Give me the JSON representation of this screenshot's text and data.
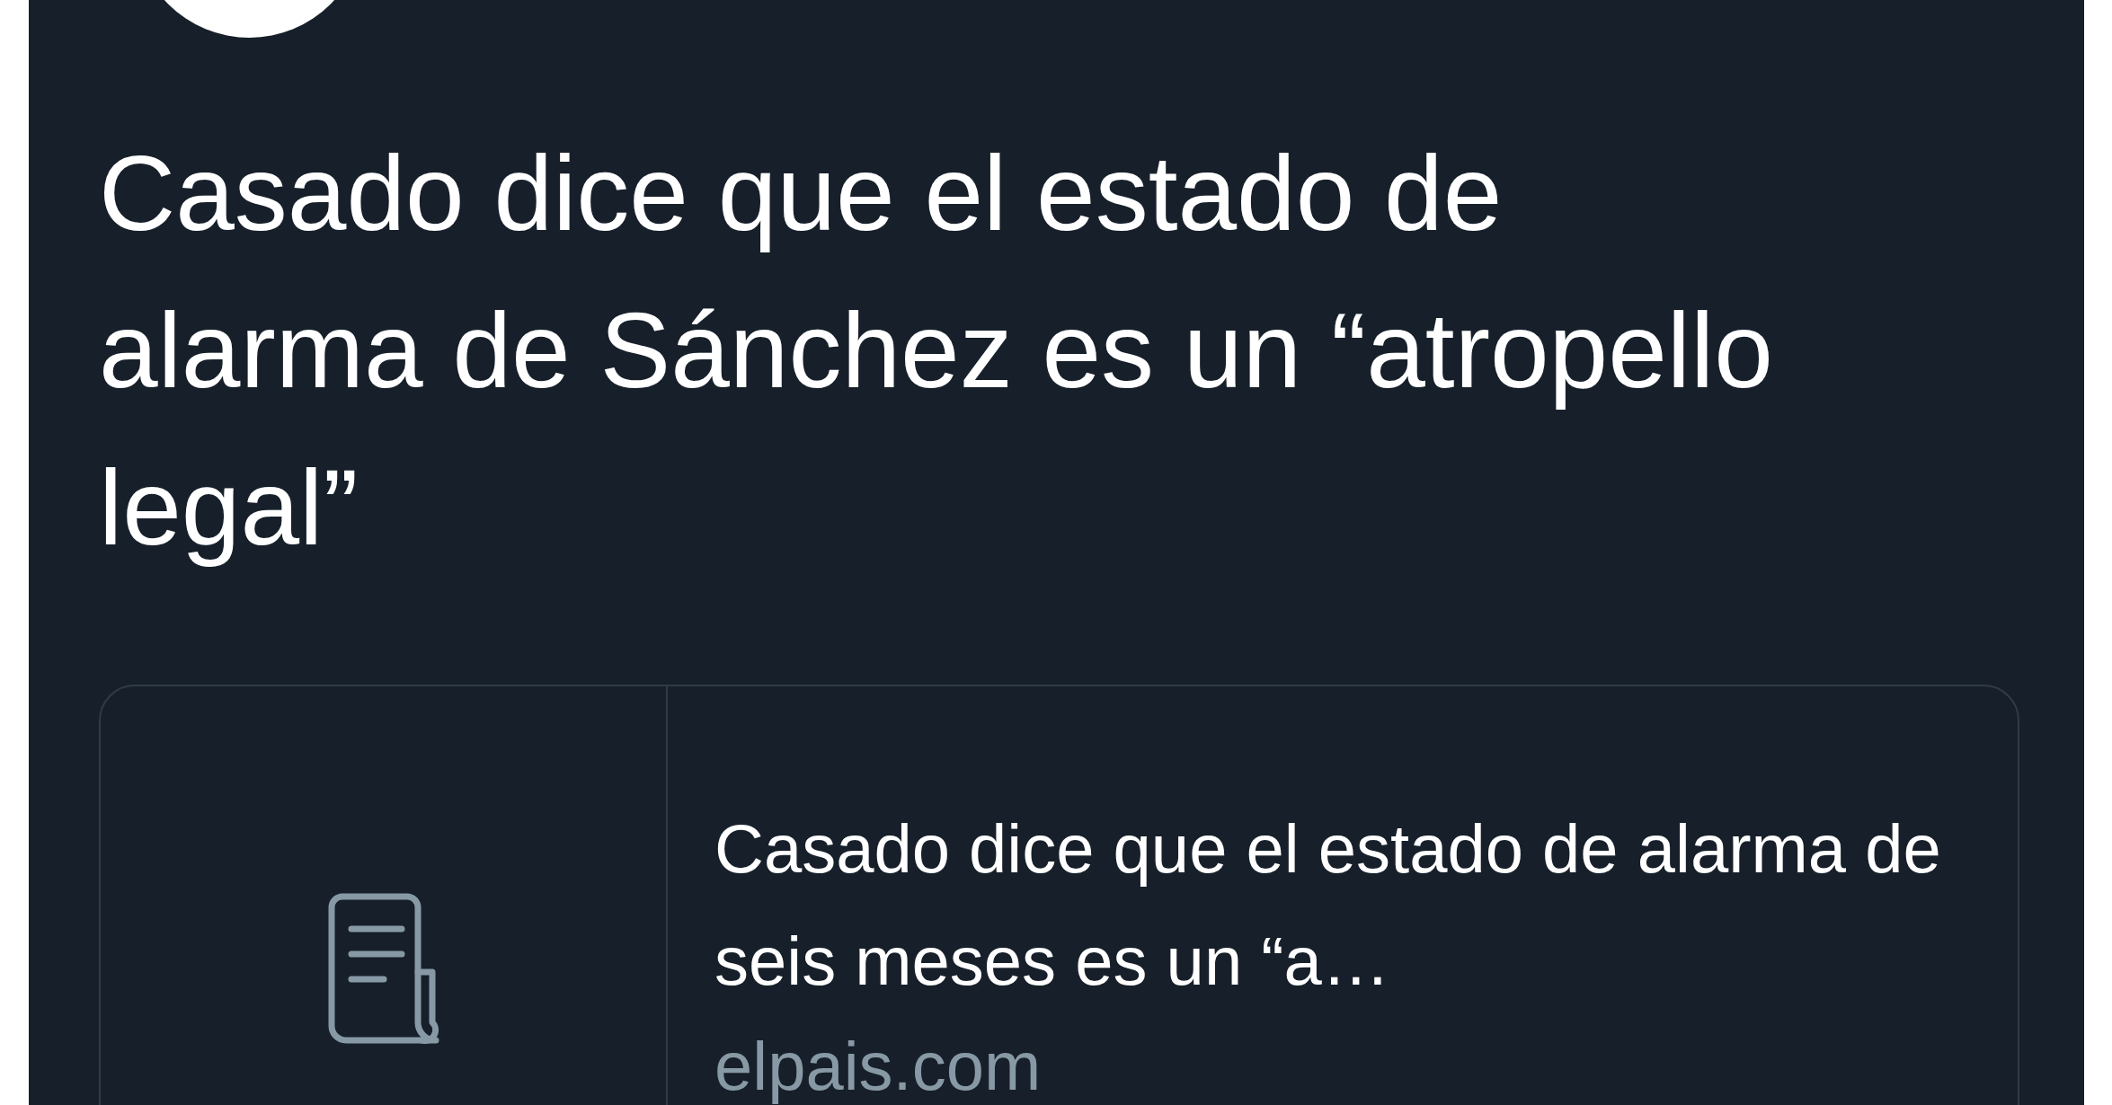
{
  "tweet": {
    "text": "Casado dice que el estado de alarma de Sánchez es un “atropello legal”",
    "link_card": {
      "kind": "article",
      "title": "Casado dice que el estado de alarma de seis meses es un “a…",
      "domain": "elpais.com"
    }
  }
}
